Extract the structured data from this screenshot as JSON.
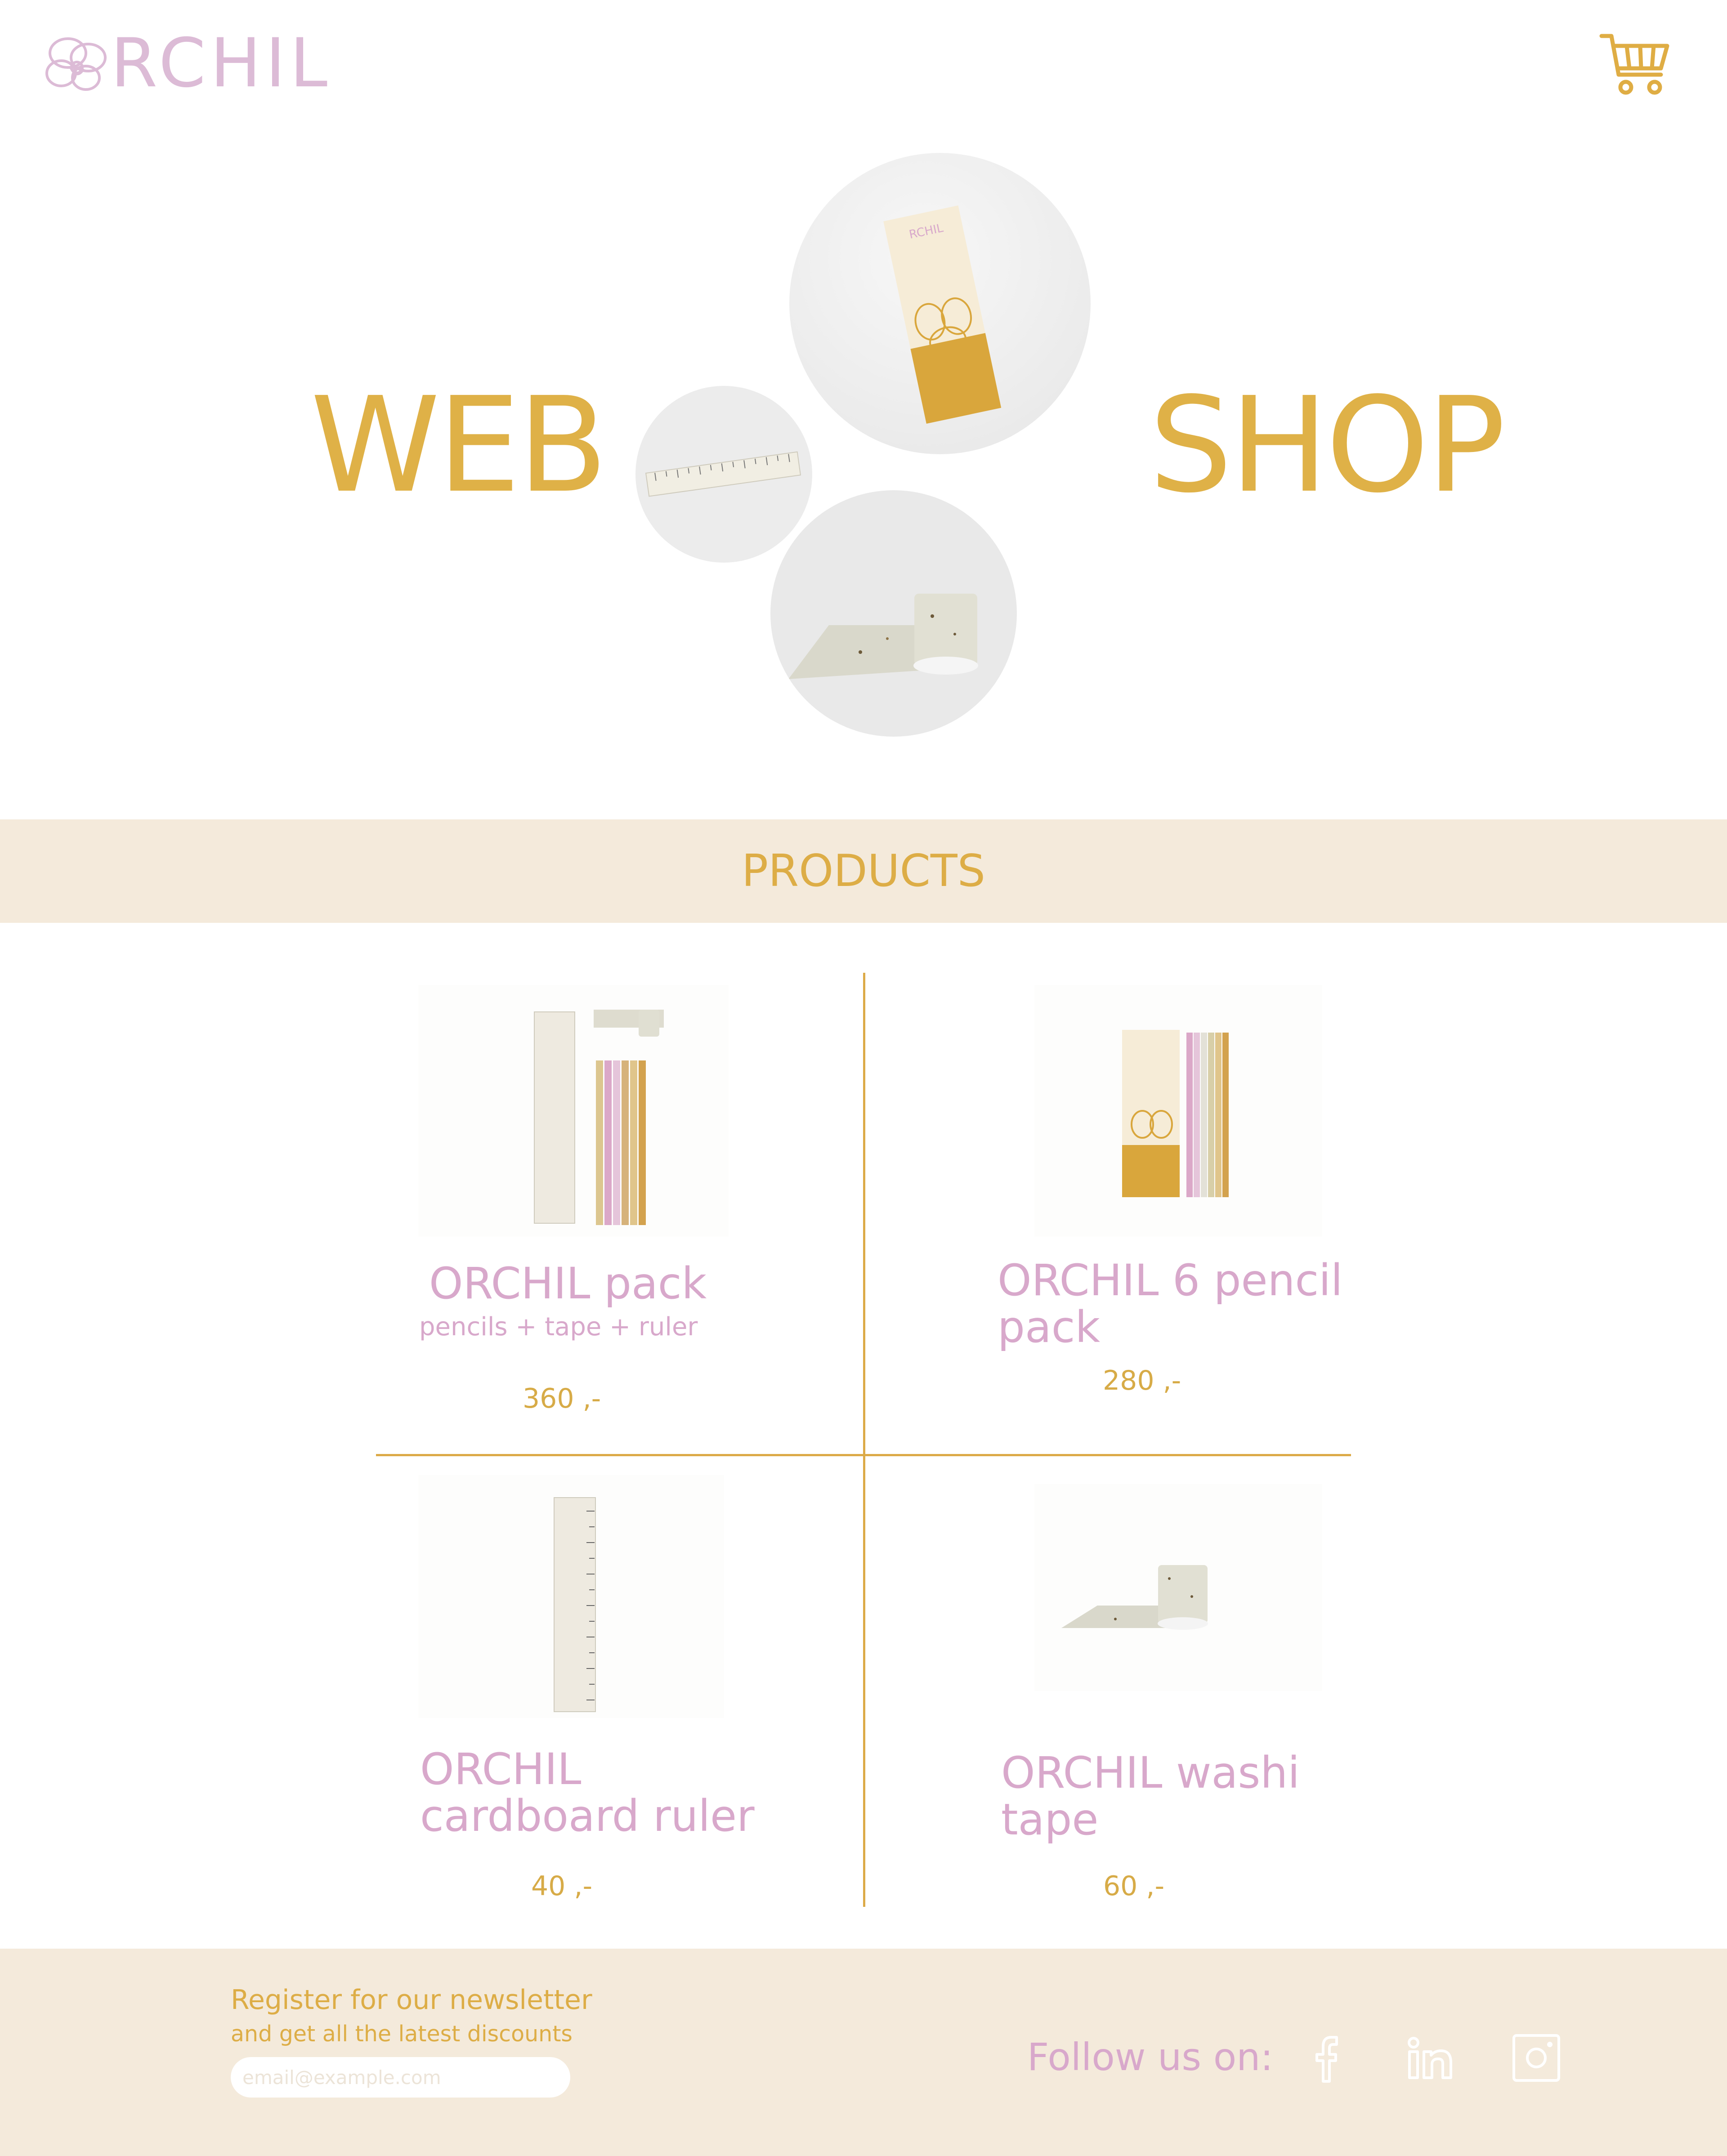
{
  "header": {
    "brand": "RCHIL",
    "cart_icon": "shopping-cart-icon"
  },
  "hero": {
    "word_left": "WEB",
    "word_right": "SHOP"
  },
  "products_section": {
    "title": "PRODUCTS",
    "items": [
      {
        "name": "ORCHIL pack",
        "subtitle": "pencils + tape + ruler",
        "price": "360 ,-"
      },
      {
        "name_line1": "ORCHIL 6 pencil",
        "name_line2": "pack",
        "price": "280 ,-"
      },
      {
        "name_line1": "ORCHIL",
        "name_line2": "cardboard ruler",
        "price": "40 ,-"
      },
      {
        "name_line1": "ORCHIL washi",
        "name_line2": "tape",
        "price": "60 ,-"
      }
    ]
  },
  "footer": {
    "newsletter_title": "Register for our newsletter",
    "newsletter_subtitle": "and get all the latest discounts",
    "email_placeholder": "email@example.com",
    "follow_label": "Follow us on:",
    "social_icons": [
      "facebook-icon",
      "linkedin-icon",
      "instagram-icon"
    ]
  },
  "colors": {
    "gold": "#dfb147",
    "pink": "#d8a8cb",
    "cream": "#f4eadb"
  }
}
